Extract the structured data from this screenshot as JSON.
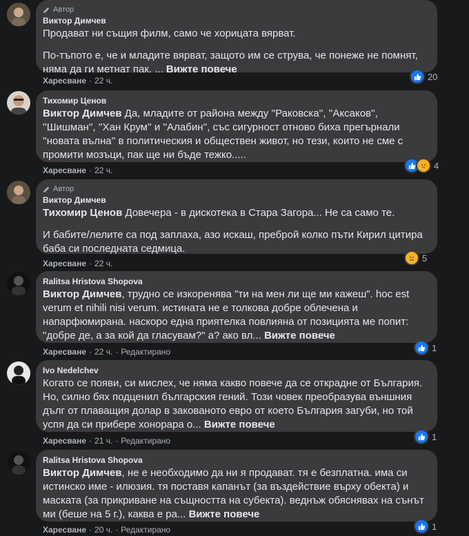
{
  "author_tag": "Автор",
  "like_label": "Харесване",
  "see_more": "Вижте повече",
  "edited_label": "Редактирано",
  "comments": [
    {
      "name": "Виктор Димчев",
      "mention": "",
      "paragraphs": [
        "Продават ни същия филм, само че хорицата вярват.",
        "По-тъпото е, че и младите вярват, защото им се струва, че понеже не помнят, няма да ги метнат пак. ..."
      ],
      "time": "22 ч.",
      "reaction_count": "20"
    },
    {
      "name": "Тихомир Ценов",
      "mention": "Виктор Димчев",
      "paragraphs": [
        "Да, младите от района между ''Раковска'', ''Аксаков'', ''Шишман'', ''Хан Крум'' и ''Алабин'', със сигурност отново биха прегърнали ''новата вълна'' в политическия и обществен живот, но тези, които не сме с промити мозъци, пак ще ни бъде тежко....."
      ],
      "time": "22 ч.",
      "reaction_count": "4"
    },
    {
      "name": "Виктор Димчев",
      "mention": "Тихомир Ценов",
      "paragraphs": [
        "Довечера - в дискотека в Стара Загора... Не са само те.",
        "И бабите/лелите са под заплаха, азо искаш, преброй колко пъти Кирил цитира баба си последната седмица."
      ],
      "time": "22 ч.",
      "reaction_count": "5"
    },
    {
      "name": "Ralitsa Hristova Shopova",
      "mention": "Виктор Димчев",
      "paragraphs": [
        ", трудно се изкоренява \"ти на мен ли ще ми кажеш\". hoc est verum et nihili nisi verum. истината не е толкова добре облечена и напарфюмирана. наскоро една приятелка повлияна от позицията ме попит: \"добре де, а за кой да гласувам?\" а? ако вл..."
      ],
      "time": "22 ч.",
      "reaction_count": "1"
    },
    {
      "name": "Ivo Nedelchev",
      "mention": "",
      "paragraphs": [
        "Когато се появи, си мислех, че няма какво повече да се открадне от България. Но, силно бях подценил българския гений. Този човек преобразува външния дълг от плаващия долар в закованото евро от което България загуби, но той успя да си прибере хонорара о..."
      ],
      "time": "21 ч.",
      "reaction_count": "1"
    },
    {
      "name": "Ralitsa Hristova Shopova",
      "mention": "Виктор Димчев",
      "paragraphs": [
        ", не е необходимо да ни я продават. тя е безплатна. има си истинско име - илюзия. тя поставя капанът (за въздействие върху обекта) и маската (за прикриване на същността на субекта). веднъж обяснявах на сънът ми (беше на 5 г.), каква е ра..."
      ],
      "time": "20 ч.",
      "reaction_count": "1"
    }
  ]
}
